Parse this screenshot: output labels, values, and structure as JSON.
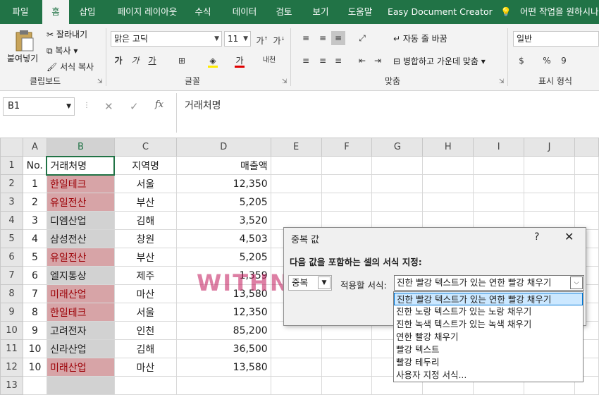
{
  "tabs": [
    "파일",
    "홈",
    "삽입",
    "페이지 레이아웃",
    "수식",
    "데이터",
    "검토",
    "보기",
    "도움말",
    "Easy Document Creator"
  ],
  "tell_me": "어떤 작업을 원하시나",
  "ribbon": {
    "paste": "붙여넣기",
    "cut": "잘라내기",
    "copy": "복사",
    "format_painter": "서식 복사",
    "clipboard_label": "클립보드",
    "font_name": "맑은 고딕",
    "font_size": "11",
    "bold": "가",
    "italic": "가",
    "underline": "가",
    "phonetic": "내천",
    "font_label": "글꼴",
    "wrap_text": "자동 줄 바꿈",
    "merge_center": "병합하고 가운데 맞춤",
    "align_label": "맞춤",
    "number_format": "일반",
    "percent": "%",
    "comma": "9",
    "number_label": "표시 형식"
  },
  "formula_bar": {
    "name_box": "B1",
    "content": "거래처명",
    "fx": "fx"
  },
  "columns": [
    "A",
    "B",
    "C",
    "D",
    "E",
    "F",
    "G",
    "H",
    "I",
    "J"
  ],
  "rows": [
    {
      "num": "1",
      "a": "No.",
      "b": "거래처명",
      "c": "지역명",
      "d": "매출액",
      "dup": false
    },
    {
      "num": "2",
      "a": "1",
      "b": "한일테크",
      "c": "서울",
      "d": "12,350",
      "dup": true
    },
    {
      "num": "3",
      "a": "2",
      "b": "유일전산",
      "c": "부산",
      "d": "5,205",
      "dup": true
    },
    {
      "num": "4",
      "a": "3",
      "b": "디엠산업",
      "c": "김해",
      "d": "3,520",
      "dup": false
    },
    {
      "num": "5",
      "a": "4",
      "b": "삼성전산",
      "c": "창원",
      "d": "4,503",
      "dup": false
    },
    {
      "num": "6",
      "a": "5",
      "b": "유일전산",
      "c": "부산",
      "d": "5,205",
      "dup": true
    },
    {
      "num": "7",
      "a": "6",
      "b": "엘지통상",
      "c": "제주",
      "d": "1,359",
      "dup": false
    },
    {
      "num": "8",
      "a": "7",
      "b": "미래산업",
      "c": "마산",
      "d": "13,580",
      "dup": true
    },
    {
      "num": "9",
      "a": "8",
      "b": "한일테크",
      "c": "서울",
      "d": "12,350",
      "dup": true
    },
    {
      "num": "10",
      "a": "9",
      "b": "고려전자",
      "c": "인천",
      "d": "85,200",
      "dup": false
    },
    {
      "num": "11",
      "a": "10",
      "b": "신라산업",
      "c": "김해",
      "d": "36,500",
      "dup": false
    },
    {
      "num": "12",
      "a": "10",
      "b": "미래산업",
      "c": "마산",
      "d": "13,580",
      "dup": true
    },
    {
      "num": "13",
      "a": "",
      "b": "",
      "c": "",
      "d": "",
      "dup": false
    }
  ],
  "dialog": {
    "title": "중복 값",
    "help": "?",
    "close": "✕",
    "prompt": "다음 값을 포함하는 셀의 서식 지정:",
    "type_value": "중복",
    "apply_label": "적용할 서식:",
    "format_value": "진한 빨강 텍스트가 있는 연한 빨강 채우기",
    "options": [
      "진한 빨강 텍스트가 있는 연한 빨강 채우기",
      "진한 노랑 텍스트가 있는 노랑 채우기",
      "진한 녹색 텍스트가 있는 녹색 채우기",
      "연한 빨강 채우기",
      "빨강 텍스트",
      "빨강 테두리",
      "사용자 지정 서식..."
    ]
  },
  "watermark": "WITHN",
  "colors": {
    "accent": "#217346",
    "dup_fill": "#d7a4a7",
    "dup_text": "#9c0006"
  }
}
